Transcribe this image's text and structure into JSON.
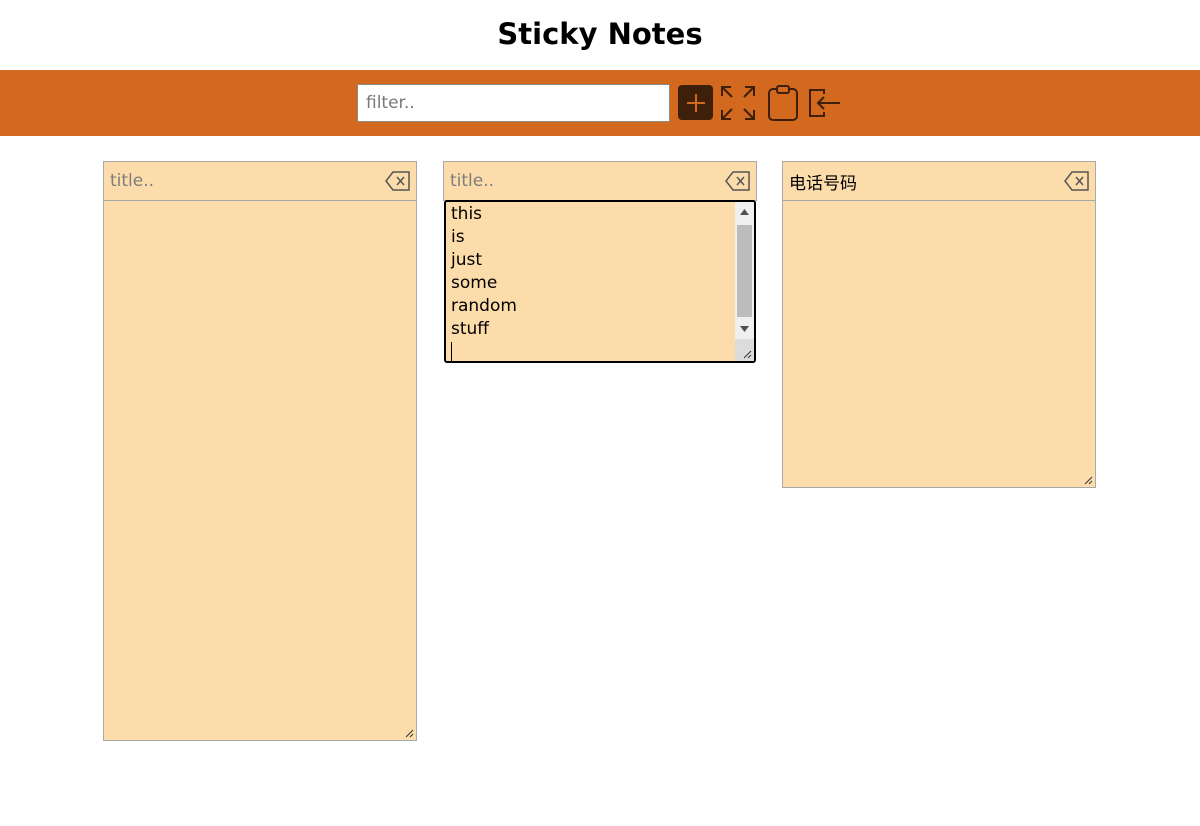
{
  "app": {
    "title": "Sticky Notes"
  },
  "toolbar": {
    "filter_placeholder": "filter..",
    "filter_value": "",
    "icons": [
      "plus-icon",
      "expand-icon",
      "clipboard-icon",
      "import-icon"
    ]
  },
  "notes": [
    {
      "title": "",
      "title_placeholder": "title..",
      "body_lines": []
    },
    {
      "title": "",
      "title_placeholder": "title..",
      "body_lines": [
        "this",
        "is",
        "just",
        "some",
        "random",
        "stuff"
      ]
    },
    {
      "title": "电话号码",
      "title_placeholder": "title..",
      "body_lines": []
    }
  ],
  "colors": {
    "toolbar_bg": "#d2691e",
    "note_bg": "#fcdcaa",
    "add_button_bg": "#3d1f0a",
    "icon_color": "#3d1f0a"
  }
}
